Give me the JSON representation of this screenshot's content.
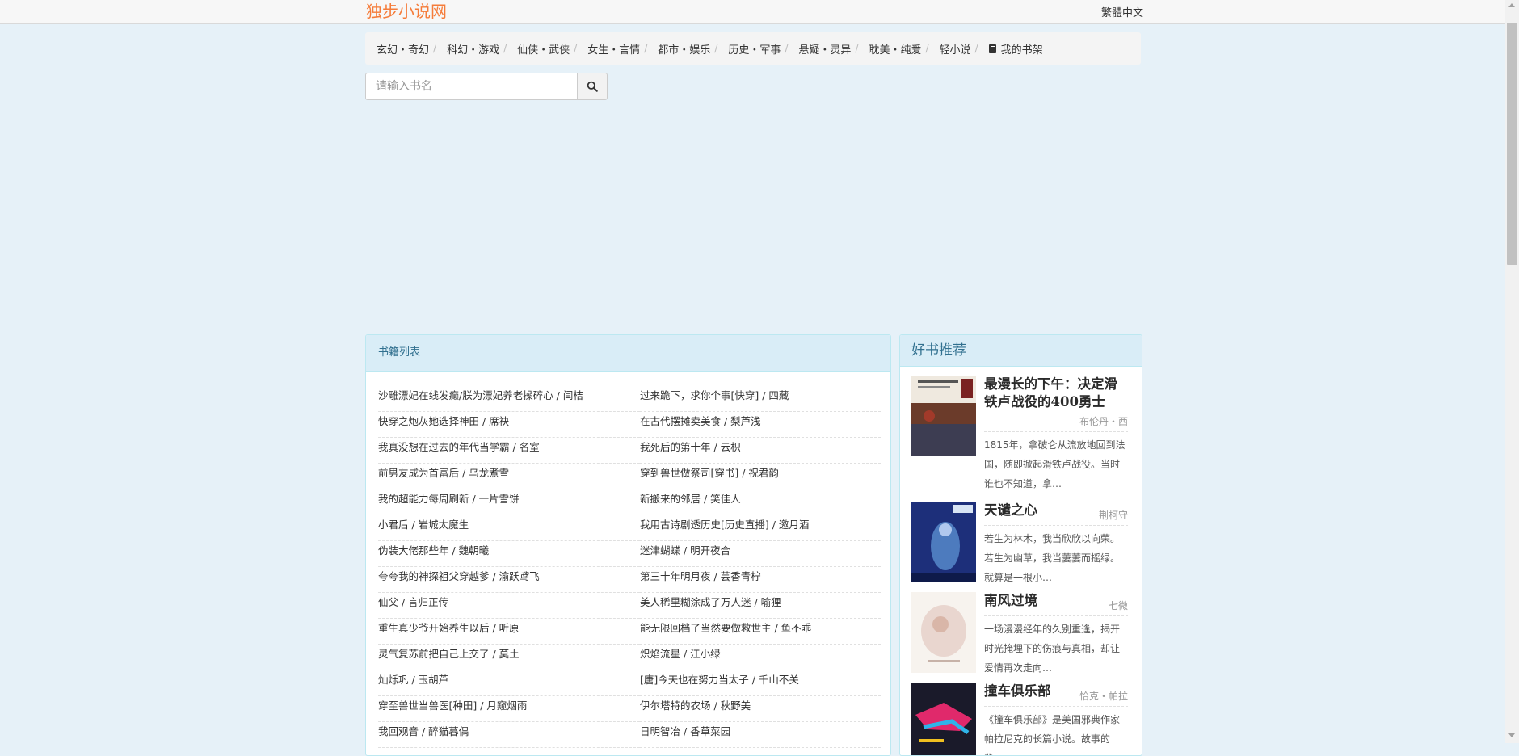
{
  "header": {
    "brand": "独步小说网",
    "lang_toggle": "繁體中文"
  },
  "nav": {
    "items": [
      "玄幻・奇幻",
      "科幻・游戏",
      "仙侠・武侠",
      "女生・言情",
      "都市・娱乐",
      "历史・军事",
      "悬疑・灵异",
      "耽美・纯爱",
      "轻小说"
    ],
    "shelf_label": "我的书架",
    "separator": "/"
  },
  "search": {
    "placeholder": "请输入书名"
  },
  "book_list": {
    "title": "书籍列表",
    "books": [
      "沙雕漂妃在线发癫/朕为漂妃养老操碎心 / 闫桔",
      "过来跪下，求你个事[快穿] / 四藏",
      "快穿之炮灰她选择神田 / 席袂",
      "在古代摆摊卖美食 / 梨芦浅",
      "我真没想在过去的年代当学霸 / 名室",
      "我死后的第十年 / 云枳",
      "前男友成为首富后 / 乌龙煮雪",
      "穿到兽世做祭司[穿书] / 祝君韵",
      "我的超能力每周刷新 / 一片雪饼",
      "新搬来的邻居 / 笑佳人",
      "小君后 / 岩城太魔生",
      "我用古诗剧透历史[历史直播] / 邀月酒",
      "伪装大佬那些年 / 魏朝曦",
      "迷津蝴蝶 / 明开夜合",
      "夸夸我的神探祖父穿越爹 / 渝跃鸢飞",
      "第三十年明月夜 / 芸香青柠",
      "仙父 / 言归正传",
      "美人稀里糊涂成了万人迷 / 喻狸",
      "重生真少爷开始养生以后 / 听原",
      "能无限回档了当然要做救世主 / 鱼不乖",
      "灵气复苏前把自己上交了 / 莫土",
      "炽焰流星 / 江小绿",
      "灿烁巩 / 玉胡芦",
      "[唐]今天也在努力当太子 / 千山不关",
      "穿至兽世当兽医[种田] / 月窥烟雨",
      "伊尔塔特的农场 / 秋野美",
      "我回观音 / 醉猫暮偶",
      "日明智冶 / 香草菜园"
    ]
  },
  "recommendations": {
    "title": "好书推荐",
    "items": [
      {
        "title": "最漫长的下午：决定滑铁卢战役的400勇士",
        "author": "布伦丹・西",
        "desc": "1815年，拿破仑从流放地回到法国，随即掀起滑铁卢战役。当时谁也不知道，拿…",
        "cover_color": "#6b3b2a"
      },
      {
        "title": "天谴之心",
        "author": "荆柯守",
        "desc": "若生为林木，我当欣欣以向荣。若生为幽草，我当萋萋而摇绿。就算是一根小…",
        "cover_color": "#1d2f7a"
      },
      {
        "title": "南风过境",
        "author": "七微",
        "desc": "一场漫漫经年的久别重逢，揭开时光掩埋下的伤痕与真相，却让爱情再次走向…",
        "cover_color": "#f3ece6"
      },
      {
        "title": "撞车俱乐部",
        "author": "恰克・帕拉",
        "desc": "《撞车俱乐部》是美国邪典作家帕拉尼克的长篇小说。故事的背…",
        "cover_color": "#1a1a2a"
      }
    ]
  }
}
